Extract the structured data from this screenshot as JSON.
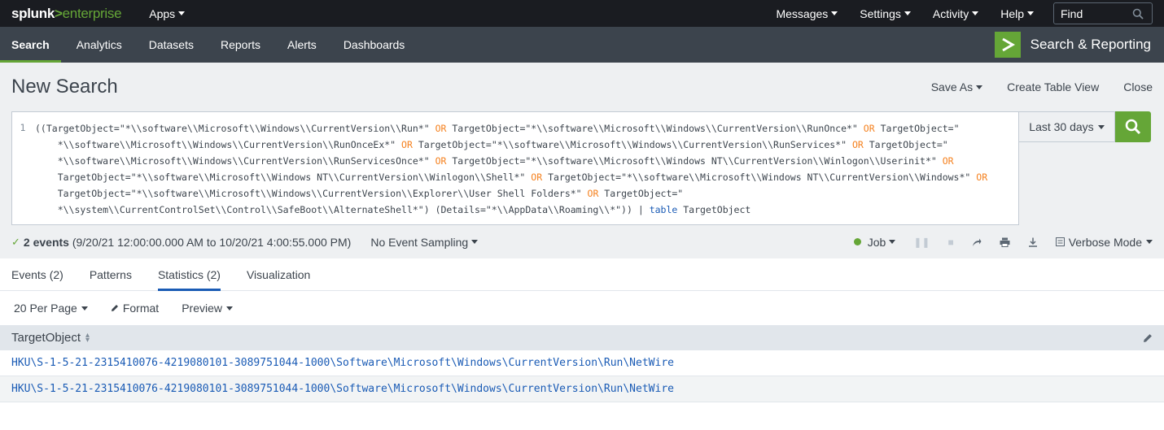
{
  "topbar": {
    "logo_splunk": "splunk",
    "logo_gt": ">",
    "logo_enterprise": "enterprise",
    "apps_label": "Apps",
    "menus": [
      "Messages",
      "Settings",
      "Activity",
      "Help"
    ],
    "find_placeholder": "Find"
  },
  "appbar": {
    "tabs": [
      "Search",
      "Analytics",
      "Datasets",
      "Reports",
      "Alerts",
      "Dashboards"
    ],
    "active_tab": "Search",
    "app_title": "Search & Reporting"
  },
  "header": {
    "title": "New Search",
    "save_as": "Save As",
    "create_table_view": "Create Table View",
    "close": "Close"
  },
  "search": {
    "line_number": "1",
    "query_lines": [
      "((TargetObject=\"*\\\\software\\\\Microsoft\\\\Windows\\\\CurrentVersion\\\\Run*\" OR TargetObject=\"*\\\\software\\\\Microsoft\\\\Windows\\\\CurrentVersion\\\\RunOnce*\" OR TargetObject=\"",
      "    *\\\\software\\\\Microsoft\\\\Windows\\\\CurrentVersion\\\\RunOnceEx*\" OR TargetObject=\"*\\\\software\\\\Microsoft\\\\Windows\\\\CurrentVersion\\\\RunServices*\" OR TargetObject=\"",
      "    *\\\\software\\\\Microsoft\\\\Windows\\\\CurrentVersion\\\\RunServicesOnce*\" OR TargetObject=\"*\\\\software\\\\Microsoft\\\\Windows NT\\\\CurrentVersion\\\\Winlogon\\\\Userinit*\" OR",
      "    TargetObject=\"*\\\\software\\\\Microsoft\\\\Windows NT\\\\CurrentVersion\\\\Winlogon\\\\Shell*\" OR TargetObject=\"*\\\\software\\\\Microsoft\\\\Windows NT\\\\CurrentVersion\\\\Windows*\" OR",
      "    TargetObject=\"*\\\\software\\\\Microsoft\\\\Windows\\\\CurrentVersion\\\\Explorer\\\\User Shell Folders*\" OR TargetObject=\"",
      "    *\\\\system\\\\CurrentControlSet\\\\Control\\\\SafeBoot\\\\AlternateShell*\") (Details=\"*\\\\AppData\\\\Roaming\\\\*\")) | table TargetObject"
    ],
    "time_range": "Last 30 days"
  },
  "status": {
    "events": "2 events",
    "range": "(9/20/21 12:00:00.000 AM to 10/20/21 4:00:55.000 PM)",
    "sampling": "No Event Sampling",
    "job": "Job",
    "mode": "Verbose Mode"
  },
  "results_tabs": [
    "Events (2)",
    "Patterns",
    "Statistics (2)",
    "Visualization"
  ],
  "active_results_tab": "Statistics (2)",
  "toolbar": {
    "per_page": "20 Per Page",
    "format": "Format",
    "preview": "Preview"
  },
  "table": {
    "column": "TargetObject",
    "rows": [
      "HKU\\S-1-5-21-2315410076-4219080101-3089751044-1000\\Software\\Microsoft\\Windows\\CurrentVersion\\Run\\NetWire",
      "HKU\\S-1-5-21-2315410076-4219080101-3089751044-1000\\Software\\Microsoft\\Windows\\CurrentVersion\\Run\\NetWire"
    ]
  },
  "colors": {
    "accent_green": "#65a637",
    "topbar_bg": "#1a1c21",
    "appbar_bg": "#3c444d",
    "link_blue": "#1a5bb5",
    "operator_orange": "#f58220"
  }
}
